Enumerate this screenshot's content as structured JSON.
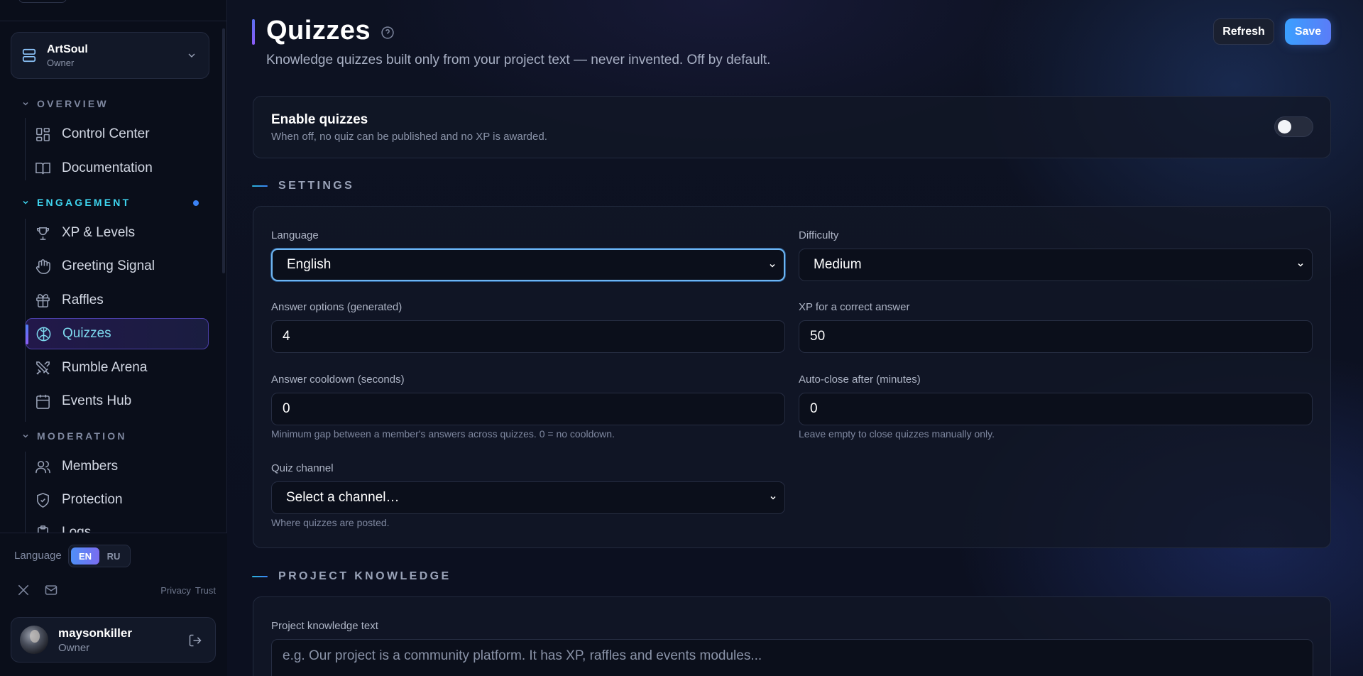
{
  "workspace": {
    "name": "ArtSoul",
    "role": "Owner"
  },
  "sidebar": {
    "sections": [
      {
        "title": "OVERVIEW",
        "items": [
          {
            "label": "Control Center",
            "icon": "dashboard-icon"
          },
          {
            "label": "Documentation",
            "icon": "book-icon"
          }
        ]
      },
      {
        "title": "ENGAGEMENT",
        "items": [
          {
            "label": "XP & Levels",
            "icon": "trophy-icon"
          },
          {
            "label": "Greeting Signal",
            "icon": "hand-wave-icon"
          },
          {
            "label": "Raffles",
            "icon": "gift-icon"
          },
          {
            "label": "Quizzes",
            "icon": "brain-icon",
            "active": true
          },
          {
            "label": "Rumble Arena",
            "icon": "crossed-swords-icon"
          },
          {
            "label": "Events Hub",
            "icon": "calendar-icon"
          }
        ]
      },
      {
        "title": "MODERATION",
        "items": [
          {
            "label": "Members",
            "icon": "users-icon"
          },
          {
            "label": "Protection",
            "icon": "shield-check-icon"
          },
          {
            "label": "Logs",
            "icon": "clipboard-icon"
          }
        ]
      }
    ]
  },
  "footer": {
    "language_label": "Language",
    "languages": [
      "EN",
      "RU"
    ],
    "selected_language": "EN",
    "links": [
      "Privacy",
      "Trust"
    ],
    "user": {
      "name": "maysonkiller",
      "role": "Owner"
    }
  },
  "page": {
    "title": "Quizzes",
    "subtitle": "Knowledge quizzes built only from your project text — never invented. Off by default.",
    "refresh_label": "Refresh",
    "save_label": "Save"
  },
  "enable": {
    "title": "Enable quizzes",
    "description": "When off, no quiz can be published and no XP is awarded.",
    "enabled": false
  },
  "settings": {
    "section_title": "SETTINGS",
    "language": {
      "label": "Language",
      "value": "English"
    },
    "difficulty": {
      "label": "Difficulty",
      "value": "Medium"
    },
    "answer_options": {
      "label": "Answer options (generated)",
      "value": "4"
    },
    "xp_correct": {
      "label": "XP for a correct answer",
      "value": "50"
    },
    "cooldown": {
      "label": "Answer cooldown (seconds)",
      "value": "0",
      "help": "Minimum gap between a member's answers across quizzes. 0 = no cooldown."
    },
    "autoclose": {
      "label": "Auto-close after (minutes)",
      "value": "0",
      "help": "Leave empty to close quizzes manually only."
    },
    "channel": {
      "label": "Quiz channel",
      "value": "Select a channel…",
      "help": "Where quizzes are posted."
    }
  },
  "knowledge": {
    "section_title": "PROJECT KNOWLEDGE",
    "label": "Project knowledge text",
    "placeholder": "e.g. Our project is a community platform. It has XP, raffles and events modules..."
  },
  "colors": {
    "accent": "#3fd6f0",
    "primary": "#4f8ff7",
    "active_border": "#4b3fa8",
    "background": "#0b0f1c"
  }
}
